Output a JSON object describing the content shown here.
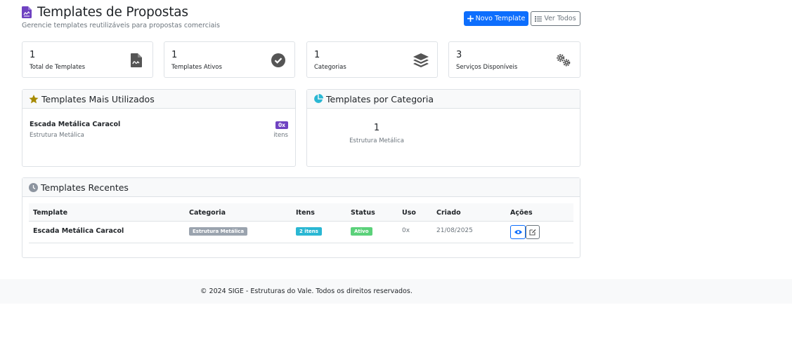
{
  "header": {
    "title": "Templates de Propostas",
    "subtitle": "Gerencie templates reutilizáveis para propostas comerciais",
    "new_button": "Novo Template",
    "view_all_button": "Ver Todos",
    "title_icon": "file-contract-icon"
  },
  "stats": [
    {
      "value": "1",
      "label": "Total de Templates",
      "icon": "file-signature-icon"
    },
    {
      "value": "1",
      "label": "Templates Ativos",
      "icon": "check-circle-icon"
    },
    {
      "value": "1",
      "label": "Categorias",
      "icon": "layers-icon"
    },
    {
      "value": "3",
      "label": "Serviços Disponíveis",
      "icon": "cogs-icon"
    }
  ],
  "most_used": {
    "title": "Templates Mais Utilizados",
    "items": [
      {
        "name": "Escada Metálica Caracol",
        "category": "Estrutura Metálica",
        "badge": "0x",
        "unit": "itens"
      }
    ]
  },
  "by_category": {
    "title": "Templates por Categoria",
    "items": [
      {
        "count": "1",
        "name": "Estrutura Metálica"
      }
    ]
  },
  "recent": {
    "title": "Templates Recentes",
    "columns": [
      "Template",
      "Categoria",
      "Itens",
      "Status",
      "Uso",
      "Criado",
      "Ações"
    ],
    "rows": [
      {
        "template": "Escada Metálica Caracol",
        "category": "Estrutura Metálica",
        "items": "2 itens",
        "status": "Ativo",
        "usage": "0x",
        "created": "21/08/2025"
      }
    ]
  },
  "footer": {
    "text": "© 2024 SIGE - Estruturas do Vale. Todos os direitos reservados."
  },
  "colors": {
    "primary": "#0d6efd",
    "purple": "#6f42c1",
    "gray_badge": "#9aa3ae",
    "info_badge": "#2ab7d3",
    "success_badge": "#5bd17a",
    "star": "#a68a00",
    "pie": "#2ab7d3"
  }
}
